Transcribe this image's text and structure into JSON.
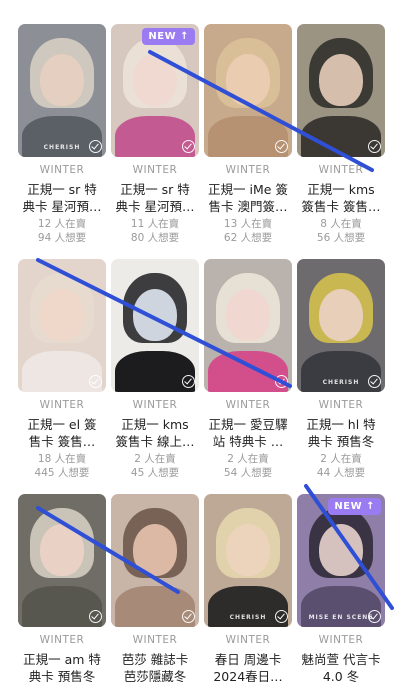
{
  "cards": [
    {
      "artist": "WINTER",
      "title": "正規一 sr 特\n典卡 星河預…",
      "sellers": "12 人在賣",
      "wants": "94 人想要",
      "new": false,
      "wm": "CHERISH",
      "bg": "#8d8f97",
      "hair": "#d9d2c5",
      "face": "#e8cfc0",
      "body": "#5b5f66"
    },
    {
      "artist": "WINTER",
      "title": "正規一 sr 特\n典卡 星河預…",
      "sellers": "11 人在賣",
      "wants": "80 人想要",
      "new": true,
      "new_label": "NEW ↑",
      "wm": "",
      "bg": "#d6c7bf",
      "hair": "#efe4d8",
      "face": "#f0d8cf",
      "body": "#c45a92"
    },
    {
      "artist": "WINTER",
      "title": "正規一 iMe 簽\n售卡 澳門簽…",
      "sellers": "13 人在賣",
      "wants": "62 人想要",
      "new": false,
      "wm": "",
      "bg": "#c7a98b",
      "hair": "#dcc39a",
      "face": "#ebcdb4",
      "body": "#b69272"
    },
    {
      "artist": "WINTER",
      "title": "正規一 kms\n簽售卡 簽售…",
      "sellers": "8 人在賣",
      "wants": "56 人想要",
      "new": false,
      "wm": "",
      "bg": "#9b9483",
      "hair": "#2c2a27",
      "face": "#e5cdb9",
      "body": "#3b3834"
    },
    {
      "artist": "WINTER",
      "title": "正規一 el 簽\n售卡 簽售…",
      "sellers": "18 人在賣",
      "wants": "445 人想要",
      "new": false,
      "wm": "",
      "bg": "#e3d5cc",
      "hair": "#e8dccf",
      "face": "#f0d6c8",
      "body": "#ede6e3"
    },
    {
      "artist": "WINTER",
      "title": "正規一 kms\n簽售卡 線上…",
      "sellers": "2 人在賣",
      "wants": "45 人想要",
      "new": false,
      "wm": "",
      "bg": "#ecebe7",
      "hair": "#1f1f22",
      "face": "#dfe6ef",
      "body": "#1c1c1e"
    },
    {
      "artist": "WINTER",
      "title": "正規一 愛豆驛\n站 特典卡 …",
      "sellers": "2 人在賣",
      "wants": "54 人想要",
      "new": false,
      "wm": "",
      "bg": "#b9b2ad",
      "hair": "#efe7da",
      "face": "#f1d7cf",
      "body": "#d24f8c"
    },
    {
      "artist": "WINTER",
      "title": "正規一 hl 特\n典卡 預售冬",
      "sellers": "2 人在賣",
      "wants": "44 人想要",
      "new": false,
      "wm": "CHERISH",
      "bg": "#6e6b6e",
      "hair": "#d9c44e",
      "face": "#ead1c4",
      "body": "#3a3c42"
    },
    {
      "artist": "WINTER",
      "title": "正規一 am 特\n典卡 預售冬",
      "sellers": "",
      "wants": "",
      "new": false,
      "wm": "",
      "bg": "#6f6d66",
      "hair": "#d9d3c6",
      "face": "#ecd4c6",
      "body": "#57574f"
    },
    {
      "artist": "WINTER",
      "title": "芭莎 雜誌卡\n芭莎隱藏冬",
      "sellers": "",
      "wants": "",
      "new": false,
      "wm": "",
      "bg": "#c9b5a8",
      "hair": "#6a5246",
      "face": "#e6c3ad",
      "body": "#a88a78"
    },
    {
      "artist": "WINTER",
      "title": "春日 周邊卡\n2024春日…",
      "sellers": "",
      "wants": "",
      "new": false,
      "wm": "CHERISH",
      "bg": "#bda996",
      "hair": "#e9d9b0",
      "face": "#ecd3be",
      "body": "#2e2c2a"
    },
    {
      "artist": "WINTER",
      "title": "魅尚萱 代言卡\n4.0 冬",
      "sellers": "",
      "wants": "",
      "new": true,
      "new_label": "NEW ↑",
      "wm": "MISE EN SCENE",
      "bg": "#8f7fa8",
      "hair": "#2a2632",
      "face": "#e7d1cc",
      "body": "#5a4f6e"
    }
  ]
}
